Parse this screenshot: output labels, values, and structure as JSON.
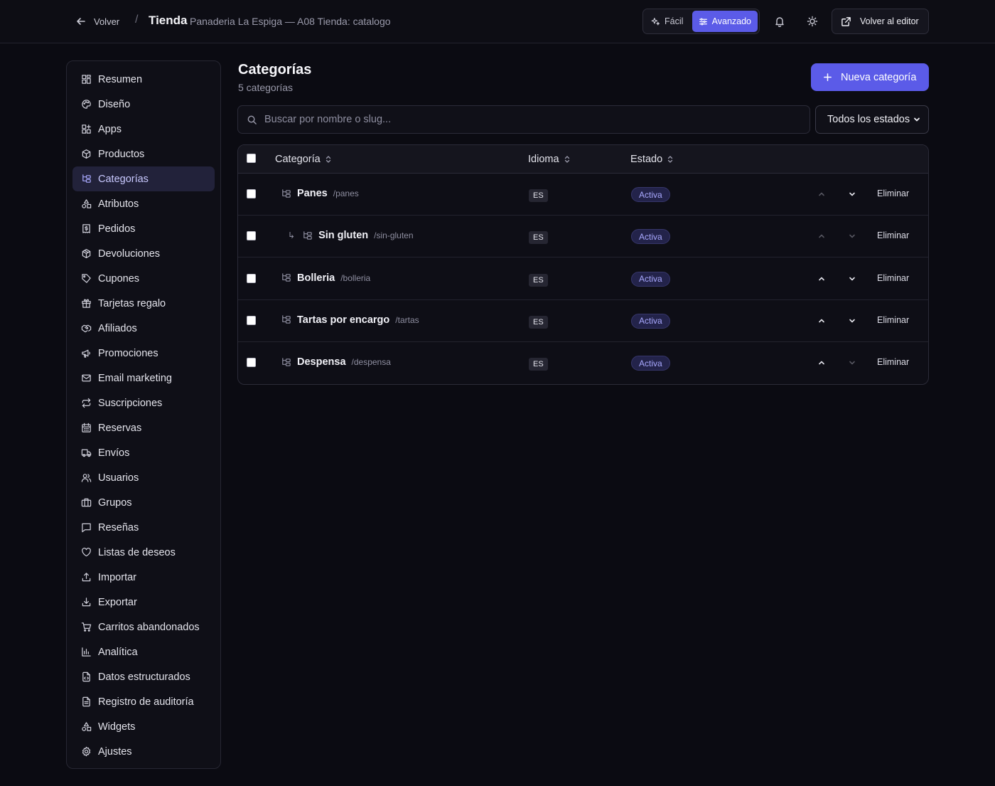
{
  "topbar": {
    "back_label": "Volver",
    "separator": "/",
    "title": "Tienda",
    "subtitle": "Panaderia La Espiga — A08 Tienda: catalogo",
    "mode_easy": "Fácil",
    "mode_advanced": "Avanzado",
    "editor_label": "Volver al editor"
  },
  "sidebar": {
    "items": [
      {
        "label": "Resumen",
        "icon": "grid-icon"
      },
      {
        "label": "Diseño",
        "icon": "palette-icon"
      },
      {
        "label": "Apps",
        "icon": "apps-icon"
      },
      {
        "label": "Productos",
        "icon": "box-icon"
      },
      {
        "label": "Categorías",
        "icon": "tree-icon",
        "active": true
      },
      {
        "label": "Atributos",
        "icon": "shapes-icon"
      },
      {
        "label": "Pedidos",
        "icon": "receipt-icon"
      },
      {
        "label": "Devoluciones",
        "icon": "package-return-icon"
      },
      {
        "label": "Cupones",
        "icon": "tag-icon"
      },
      {
        "label": "Tarjetas regalo",
        "icon": "gift-icon"
      },
      {
        "label": "Afiliados",
        "icon": "handshake-icon"
      },
      {
        "label": "Promociones",
        "icon": "megaphone-icon"
      },
      {
        "label": "Email marketing",
        "icon": "mail-icon"
      },
      {
        "label": "Suscripciones",
        "icon": "repeat-icon"
      },
      {
        "label": "Reservas",
        "icon": "calendar-icon"
      },
      {
        "label": "Envíos",
        "icon": "truck-icon"
      },
      {
        "label": "Usuarios",
        "icon": "users-icon"
      },
      {
        "label": "Grupos",
        "icon": "briefcase-icon"
      },
      {
        "label": "Reseñas",
        "icon": "message-icon"
      },
      {
        "label": "Listas de deseos",
        "icon": "heart-icon"
      },
      {
        "label": "Importar",
        "icon": "upload-icon"
      },
      {
        "label": "Exportar",
        "icon": "download-icon"
      },
      {
        "label": "Carritos abandonados",
        "icon": "cart-icon"
      },
      {
        "label": "Analítica",
        "icon": "bar-chart-icon"
      },
      {
        "label": "Datos estructurados",
        "icon": "file-code-icon"
      },
      {
        "label": "Registro de auditoría",
        "icon": "file-list-icon"
      },
      {
        "label": "Widgets",
        "icon": "shapes-icon"
      },
      {
        "label": "Ajustes",
        "icon": "gear-icon"
      }
    ]
  },
  "main": {
    "title": "Categorías",
    "subtitle": "5 categorías",
    "new_button": "Nueva categoría",
    "search_placeholder": "Buscar por nombre o slug...",
    "status_filter": "Todos los estados"
  },
  "table": {
    "columns": [
      "Categoría",
      "Idioma",
      "Estado"
    ],
    "rows": [
      {
        "name": "Panes",
        "slug": "/panes",
        "lang": "ES",
        "status": "Activa",
        "child": false,
        "up_enabled": false,
        "down_enabled": true
      },
      {
        "name": "Sin gluten",
        "slug": "/sin-gluten",
        "lang": "ES",
        "status": "Activa",
        "child": true,
        "child_marker": "↳",
        "up_enabled": false,
        "down_enabled": false
      },
      {
        "name": "Bolleria",
        "slug": "/bolleria",
        "lang": "ES",
        "status": "Activa",
        "child": false,
        "up_enabled": true,
        "down_enabled": true
      },
      {
        "name": "Tartas por encargo",
        "slug": "/tartas",
        "lang": "ES",
        "status": "Activa",
        "child": false,
        "up_enabled": true,
        "down_enabled": true
      },
      {
        "name": "Despensa",
        "slug": "/despensa",
        "lang": "ES",
        "status": "Activa",
        "child": false,
        "up_enabled": true,
        "down_enabled": false
      }
    ],
    "delete_label": "Eliminar"
  },
  "colors": {
    "accent": "#5b5be8",
    "background": "#0b0b12",
    "badge_text": "#a9a9ff"
  }
}
